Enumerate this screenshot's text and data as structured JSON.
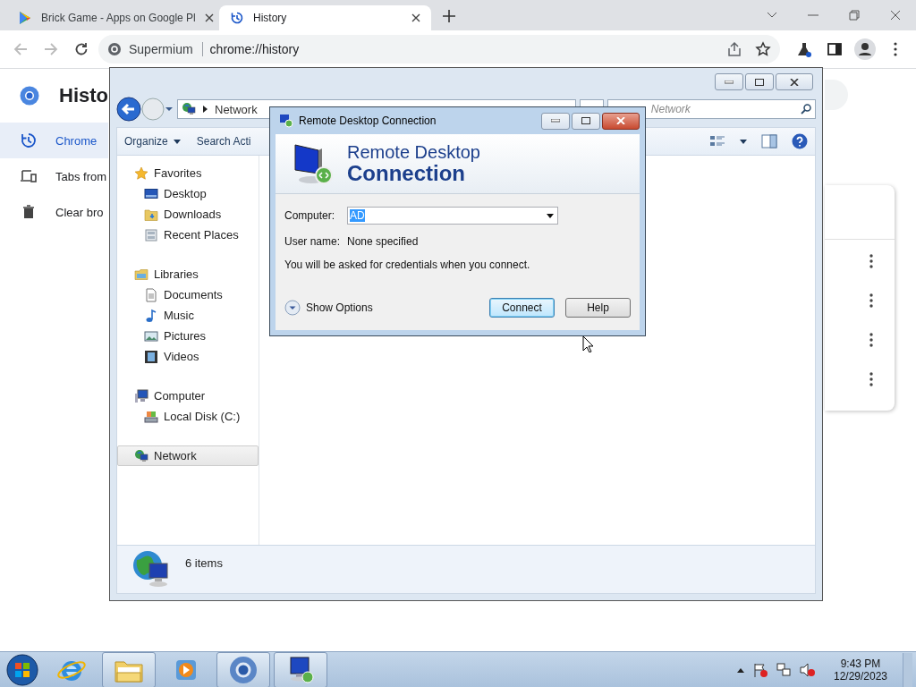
{
  "browser": {
    "tabs": [
      {
        "title": "Brick Game - Apps on Google Pl",
        "selected": false
      },
      {
        "title": "History",
        "selected": true
      }
    ],
    "omnibox": {
      "chip": "Supermium",
      "url": "chrome://history"
    }
  },
  "history_page": {
    "title": "Histo",
    "sidebar": [
      {
        "label": "Chrome",
        "kind": "history",
        "selected": true
      },
      {
        "label": "Tabs from",
        "kind": "devices",
        "selected": false
      },
      {
        "label": "Clear bro",
        "kind": "trash",
        "selected": false
      }
    ]
  },
  "explorer": {
    "address": "Network",
    "search_placeholder": "Network",
    "toolbar": [
      "Organize",
      "Search Acti"
    ],
    "nav": [
      {
        "label": "Favorites",
        "kind": "star",
        "selected": false,
        "children": [
          {
            "label": "Desktop",
            "kind": "desktop",
            "selected": false
          },
          {
            "label": "Downloads",
            "kind": "downloads",
            "selected": false
          },
          {
            "label": "Recent Places",
            "kind": "recent",
            "selected": false
          }
        ]
      },
      {
        "label": "Libraries",
        "kind": "library",
        "selected": false,
        "children": [
          {
            "label": "Documents",
            "kind": "document",
            "selected": false
          },
          {
            "label": "Music",
            "kind": "music",
            "selected": false
          },
          {
            "label": "Pictures",
            "kind": "pictures",
            "selected": false
          },
          {
            "label": "Videos",
            "kind": "videos",
            "selected": false
          }
        ]
      },
      {
        "label": "Computer",
        "kind": "computer",
        "selected": false,
        "children": [
          {
            "label": "Local Disk (C:)",
            "kind": "disk",
            "selected": false
          }
        ]
      },
      {
        "label": "Network",
        "kind": "network",
        "selected": true
      }
    ],
    "status": "6 items"
  },
  "dialog": {
    "title": "Remote Desktop Connection",
    "heading_1": "Remote Desktop",
    "heading_2": "Connection",
    "computer_label": "Computer:",
    "computer_value": "AD",
    "username_label": "User name:",
    "username_value": "None specified",
    "note": "You will be asked for credentials when you connect.",
    "options": "Show Options",
    "buttons": [
      {
        "label": "Connect",
        "default": true
      },
      {
        "label": "Help",
        "default": false
      }
    ]
  },
  "taskbar": {
    "apps": [
      {
        "kind": "ie",
        "active": false
      },
      {
        "kind": "explorer",
        "active": true
      },
      {
        "kind": "media",
        "active": false
      },
      {
        "kind": "chrome",
        "active": true
      },
      {
        "kind": "rdc",
        "active": true
      }
    ],
    "time": "9:43 PM",
    "date": "12/29/2023"
  }
}
